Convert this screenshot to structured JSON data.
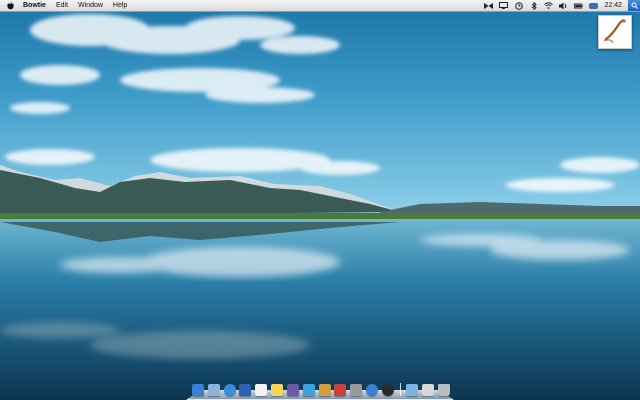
{
  "menubar": {
    "app_name": "Bowtie",
    "items": [
      "Edit",
      "Window",
      "Help"
    ],
    "clock": "22:42",
    "status_icons": [
      "bowtie-icon",
      "screen-share-icon",
      "time-machine-icon",
      "bluetooth-icon",
      "wifi-icon",
      "volume-icon",
      "battery-icon",
      "keyboard-icon"
    ]
  },
  "desktop": {
    "items": [
      {
        "kind": "image-file"
      }
    ]
  },
  "dock": {
    "apps": [
      {
        "name": "finder-icon",
        "color": "#3b7fd6"
      },
      {
        "name": "mail-icon",
        "color": "#8fb2d8"
      },
      {
        "name": "safari-icon",
        "color": "#3a8ee0"
      },
      {
        "name": "xcode-icon",
        "color": "#2f5fb0"
      },
      {
        "name": "textedit-icon",
        "color": "#f2f2f2"
      },
      {
        "name": "stickies-icon",
        "color": "#f3d75a"
      },
      {
        "name": "instruments-icon",
        "color": "#6b5aa8"
      },
      {
        "name": "preview-icon",
        "color": "#3fa1d8"
      },
      {
        "name": "package-icon",
        "color": "#d59b3f"
      },
      {
        "name": "photo-booth-icon",
        "color": "#c94040"
      },
      {
        "name": "system-preferences-icon",
        "color": "#9a9a9a"
      },
      {
        "name": "itunes-icon",
        "color": "#3c7fd6"
      },
      {
        "name": "activity-monitor-icon",
        "color": "#2a2a2a"
      }
    ],
    "stacks": [
      {
        "name": "folder-icon",
        "color": "#7fb3e6"
      },
      {
        "name": "screenshot-stack-icon",
        "color": "#d8d8d8"
      },
      {
        "name": "trash-icon",
        "color": "#b9bec4"
      }
    ]
  }
}
